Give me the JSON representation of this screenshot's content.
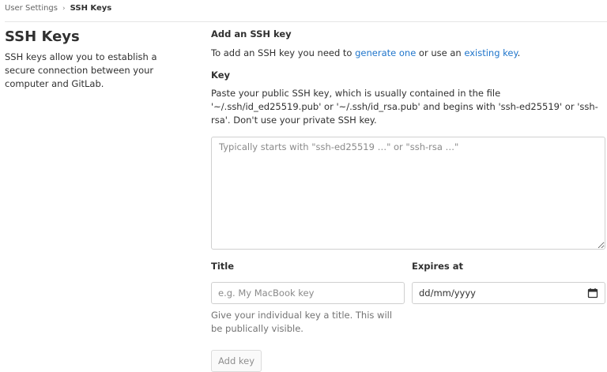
{
  "breadcrumb": {
    "parent": "User Settings",
    "current": "SSH Keys"
  },
  "left": {
    "title": "SSH Keys",
    "description": "SSH keys allow you to establish a secure connection between your computer and GitLab."
  },
  "form": {
    "heading": "Add an SSH key",
    "intro_prefix": "To add an SSH key you need to ",
    "generate_link": "generate one",
    "intro_middle": " or use an ",
    "existing_link": "existing key",
    "intro_suffix": ".",
    "key_label": "Key",
    "key_help": "Paste your public SSH key, which is usually contained in the file '~/.ssh/id_ed25519.pub' or '~/.ssh/id_rsa.pub' and begins with 'ssh-ed25519' or 'ssh-rsa'. Don't use your private SSH key.",
    "key_placeholder": "Typically starts with \"ssh-ed25519 …\" or \"ssh-rsa …\"",
    "title_label": "Title",
    "title_placeholder": "e.g. My MacBook key",
    "title_help": "Give your individual key a title. This will be publically visible.",
    "expires_label": "Expires at",
    "expires_value": "dd/mm/yyyy",
    "expires_icon": "calendar-icon",
    "submit_label": "Add key"
  },
  "colors": {
    "link": "#1f75cb",
    "text": "#303030",
    "muted": "#737373"
  }
}
